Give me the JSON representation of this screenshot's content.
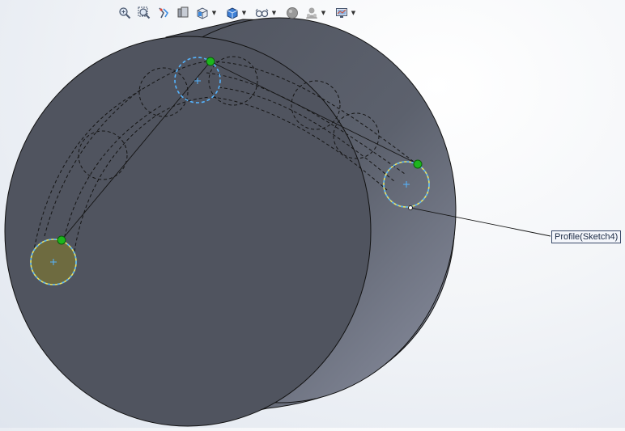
{
  "app": "SolidWorks",
  "toolbar": {
    "items": [
      {
        "name": "zoom-to-fit-icon",
        "dropdown": false
      },
      {
        "name": "zoom-to-area-icon",
        "dropdown": false
      },
      {
        "name": "previous-view-icon",
        "dropdown": false
      },
      {
        "name": "section-view-icon",
        "dropdown": false
      },
      {
        "name": "view-orientation-icon",
        "dropdown": true
      },
      {
        "name": "display-style-icon",
        "dropdown": true
      },
      {
        "name": "hide-show-items-icon",
        "dropdown": true
      },
      {
        "name": "edit-appearance-icon",
        "dropdown": false
      },
      {
        "name": "apply-scene-icon",
        "dropdown": true
      },
      {
        "name": "view-settings-icon",
        "dropdown": true
      }
    ]
  },
  "callout": {
    "label": "Profile(Sketch4)"
  },
  "colors": {
    "body": "#50545f",
    "body_side": "#6c7282",
    "sketch_dashed": "#55b4ff",
    "sketch_selected": "#e8e466",
    "endpoint": "#1db61d",
    "profile_fill": "#6e6b40"
  }
}
